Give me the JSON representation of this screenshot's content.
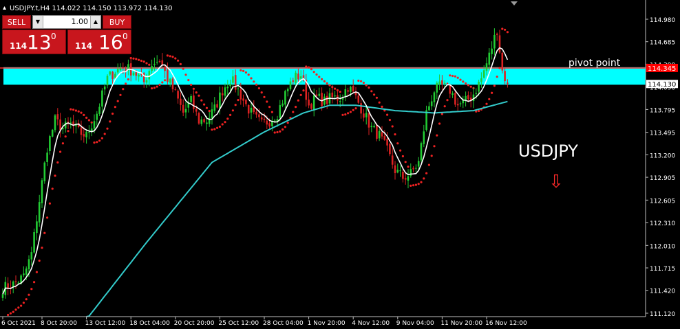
{
  "header": {
    "symbol_line": "USDJPY.t,H4  114.022 114.150 113.972 114.130"
  },
  "trade_panel": {
    "sell_label": "SELL",
    "buy_label": "BUY",
    "lot_value": "1.00",
    "sell_quote": {
      "big_figure": "114",
      "pips": "13",
      "point": "0"
    },
    "buy_quote": {
      "big_figure": "114",
      "pips": "16",
      "point": "0"
    },
    "color": "#c8161d"
  },
  "annotations": {
    "pivot_label": "pivot point",
    "symbol_title": "USDJPY",
    "down_arrow_glyph": "⇩",
    "pivot_price": 114.34,
    "zone_top_price": 114.35,
    "zone_bottom_price": 114.12
  },
  "price_axis": {
    "ticks": [
      "114.980",
      "114.685",
      "114.390",
      "114.090",
      "113.795",
      "113.495",
      "113.200",
      "112.905",
      "112.605",
      "112.310",
      "112.010",
      "111.715",
      "111.420",
      "111.120"
    ],
    "tick_values": [
      114.98,
      114.685,
      114.39,
      114.09,
      113.795,
      113.495,
      113.2,
      112.905,
      112.605,
      112.31,
      112.01,
      111.715,
      111.42,
      111.12
    ],
    "current_price_label": "114.130",
    "current_price": 114.13,
    "pivot_price_label": "114.345"
  },
  "time_axis": {
    "labels": [
      "6 Oct 2021",
      "8 Oct 20:00",
      "13 Oct 12:00",
      "18 Oct 04:00",
      "20 Oct 20:00",
      "25 Oct 12:00",
      "28 Oct 04:00",
      "1 Nov 20:00",
      "4 Nov 12:00",
      "9 Nov 04:00",
      "11 Nov 20:00",
      "16 Nov 12:00"
    ],
    "label_bar_index": [
      0,
      15,
      32,
      49,
      66,
      83,
      100,
      117,
      134,
      151,
      168,
      185
    ]
  },
  "chart_data": {
    "type": "candlestick",
    "symbol": "USDJPY",
    "timeframe": "H4",
    "ylim": [
      111.12,
      115.08
    ],
    "close_anchors": [
      [
        0,
        111.45
      ],
      [
        4,
        111.5
      ],
      [
        8,
        111.6
      ],
      [
        11,
        111.9
      ],
      [
        14,
        112.6
      ],
      [
        17,
        113.3
      ],
      [
        20,
        113.65
      ],
      [
        23,
        113.55
      ],
      [
        26,
        113.6
      ],
      [
        29,
        113.5
      ],
      [
        32,
        113.45
      ],
      [
        36,
        113.75
      ],
      [
        40,
        114.2
      ],
      [
        43,
        114.3
      ],
      [
        46,
        114.35
      ],
      [
        50,
        114.3
      ],
      [
        54,
        114.15
      ],
      [
        57,
        114.4
      ],
      [
        60,
        114.45
      ],
      [
        63,
        114.2
      ],
      [
        66,
        114.0
      ],
      [
        69,
        113.75
      ],
      [
        72,
        113.9
      ],
      [
        75,
        113.65
      ],
      [
        78,
        113.65
      ],
      [
        81,
        113.8
      ],
      [
        84,
        114.05
      ],
      [
        87,
        114.2
      ],
      [
        90,
        114.05
      ],
      [
        93,
        113.85
      ],
      [
        96,
        113.7
      ],
      [
        99,
        113.6
      ],
      [
        102,
        113.65
      ],
      [
        105,
        113.75
      ],
      [
        108,
        114.0
      ],
      [
        111,
        114.2
      ],
      [
        114,
        114.25
      ],
      [
        117,
        113.85
      ],
      [
        120,
        113.95
      ],
      [
        123,
        113.9
      ],
      [
        126,
        113.95
      ],
      [
        129,
        113.95
      ],
      [
        132,
        114.1
      ],
      [
        135,
        113.95
      ],
      [
        138,
        113.75
      ],
      [
        141,
        113.55
      ],
      [
        144,
        113.45
      ],
      [
        147,
        113.25
      ],
      [
        150,
        113.0
      ],
      [
        153,
        112.9
      ],
      [
        156,
        112.95
      ],
      [
        159,
        113.1
      ],
      [
        162,
        113.75
      ],
      [
        165,
        114.05
      ],
      [
        168,
        114.1
      ],
      [
        171,
        114.05
      ],
      [
        174,
        113.85
      ],
      [
        177,
        113.9
      ],
      [
        180,
        114.0
      ],
      [
        183,
        114.2
      ],
      [
        186,
        114.5
      ],
      [
        189,
        114.85
      ],
      [
        191,
        114.3
      ],
      [
        193,
        114.13
      ]
    ],
    "ma_slow_anchors": [
      [
        0,
        110.2
      ],
      [
        30,
        110.95
      ],
      [
        55,
        112.05
      ],
      [
        80,
        113.1
      ],
      [
        100,
        113.5
      ],
      [
        115,
        113.75
      ],
      [
        125,
        113.85
      ],
      [
        135,
        113.85
      ],
      [
        150,
        113.78
      ],
      [
        165,
        113.75
      ],
      [
        180,
        113.78
      ],
      [
        193,
        113.9
      ]
    ],
    "series": [
      {
        "name": "",
        "kind": "ohlc",
        "up_color": "#22cc33",
        "down_color": "#dd2222"
      },
      {
        "name": "",
        "kind": "moving_average_fast",
        "color": "#ffffff"
      },
      {
        "name": "",
        "kind": "moving_average_slow",
        "color": "#33cccc"
      },
      {
        "name": "",
        "kind": "parabolic_sar",
        "color": "#ee2222"
      }
    ],
    "zone_color": "#00ffff",
    "pivot_line_color": "#ff3333",
    "price_label_bg": "#ff0000"
  }
}
